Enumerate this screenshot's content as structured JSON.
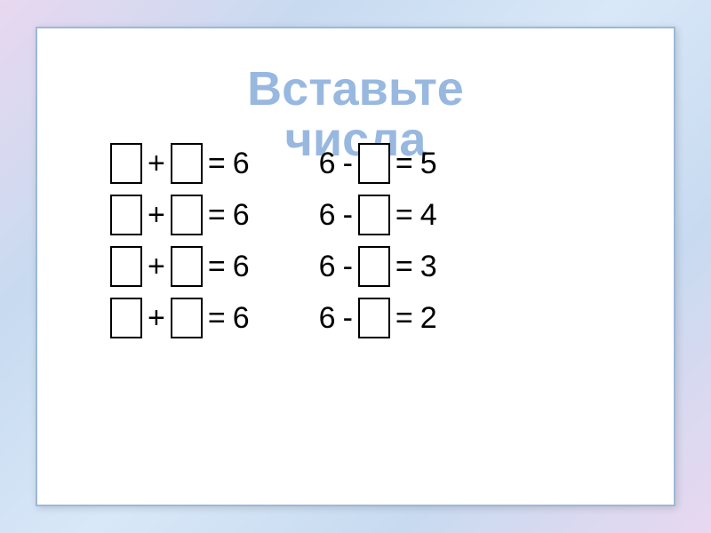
{
  "title_line1": "Вставьте",
  "title_line2": "числа",
  "left": [
    {
      "op": "+",
      "eq": "=",
      "result": "6"
    },
    {
      "op": "+",
      "eq": "=",
      "result": "6"
    },
    {
      "op": "+",
      "eq": "=",
      "result": "6"
    },
    {
      "op": "+",
      "eq": "=",
      "result": "6"
    }
  ],
  "right": [
    {
      "left": "6",
      "op": "-",
      "eq": "=",
      "result": "5"
    },
    {
      "left": "6",
      "op": "-",
      "eq": "=",
      "result": "4"
    },
    {
      "left": "6",
      "op": "-",
      "eq": "=",
      "result": "3"
    },
    {
      "left": "6",
      "op": "-",
      "eq": "=",
      "result": "2"
    }
  ]
}
